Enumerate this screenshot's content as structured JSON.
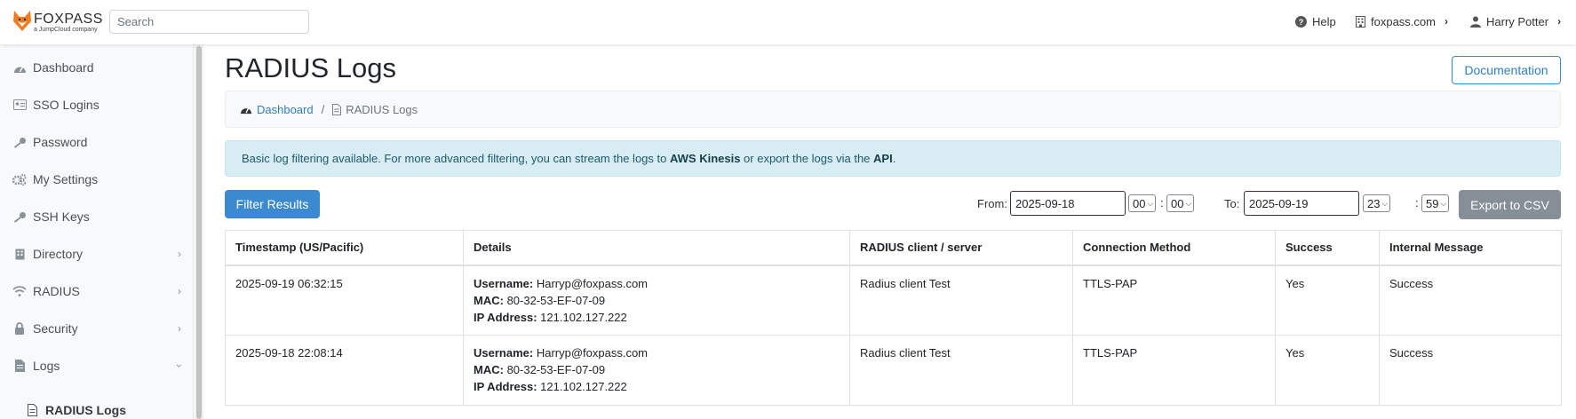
{
  "app": {
    "brand": "FOXPASS",
    "brand_sub": "a JumpCloud company",
    "colors": {
      "accent": "#3b8ad0",
      "success": "#28a745",
      "brand_orange": "#f47c20"
    }
  },
  "topbar": {
    "search_placeholder": "Search",
    "help_label": "Help",
    "domain_label": "foxpass.com",
    "user_label": "Harry Potter"
  },
  "sidebar": {
    "items": [
      {
        "label": "Dashboard",
        "icon": "dashboard-icon"
      },
      {
        "label": "SSO Logins",
        "icon": "id-card-icon"
      },
      {
        "label": "Password",
        "icon": "key-icon"
      },
      {
        "label": "My Settings",
        "icon": "gears-icon"
      },
      {
        "label": "SSH Keys",
        "icon": "key-icon"
      },
      {
        "label": "Directory",
        "icon": "building-icon"
      },
      {
        "label": "RADIUS",
        "icon": "wifi-icon"
      },
      {
        "label": "Security",
        "icon": "lock-icon"
      },
      {
        "label": "Logs",
        "icon": "file-icon"
      }
    ],
    "active_sub": "RADIUS Logs"
  },
  "page": {
    "title": "RADIUS Logs",
    "doc_button": "Documentation",
    "breadcrumb": {
      "home": "Dashboard",
      "separator": "/",
      "current": "RADIUS Logs"
    },
    "alert": {
      "pre": "Basic log filtering available. For more advanced filtering, you can stream the logs to ",
      "kinesis": "AWS Kinesis",
      "mid": " or export the logs via the ",
      "api": "API",
      "post": "."
    }
  },
  "filter": {
    "button": "Filter Results",
    "from_label": "From:",
    "from_date": "2025-09-18",
    "from_hour": "00",
    "from_min": "00",
    "to_label": "To:",
    "to_date": "2025-09-19",
    "to_hour": "23",
    "to_min": "59",
    "colon": ":",
    "export_button": "Export to CSV"
  },
  "table": {
    "headers": [
      "Timestamp (US/Pacific)",
      "Details",
      "RADIUS client / server",
      "Connection Method",
      "Success",
      "Internal Message"
    ],
    "detail_labels": {
      "username": "Username:",
      "mac": "MAC:",
      "ip": "IP Address:"
    },
    "rows": [
      {
        "timestamp": "2025-09-19 06:32:15",
        "username": "Harryp@foxpass.com",
        "mac": "80-32-53-EF-07-09",
        "ip": "121.102.127.222",
        "client": "Radius client Test",
        "method": "TTLS-PAP",
        "success": "Yes",
        "message": "Success"
      },
      {
        "timestamp": "2025-09-18 22:08:14",
        "username": "Harryp@foxpass.com",
        "mac": "80-32-53-EF-07-09",
        "ip": "121.102.127.222",
        "client": "Radius client Test",
        "method": "TTLS-PAP",
        "success": "Yes",
        "message": "Success"
      }
    ]
  }
}
